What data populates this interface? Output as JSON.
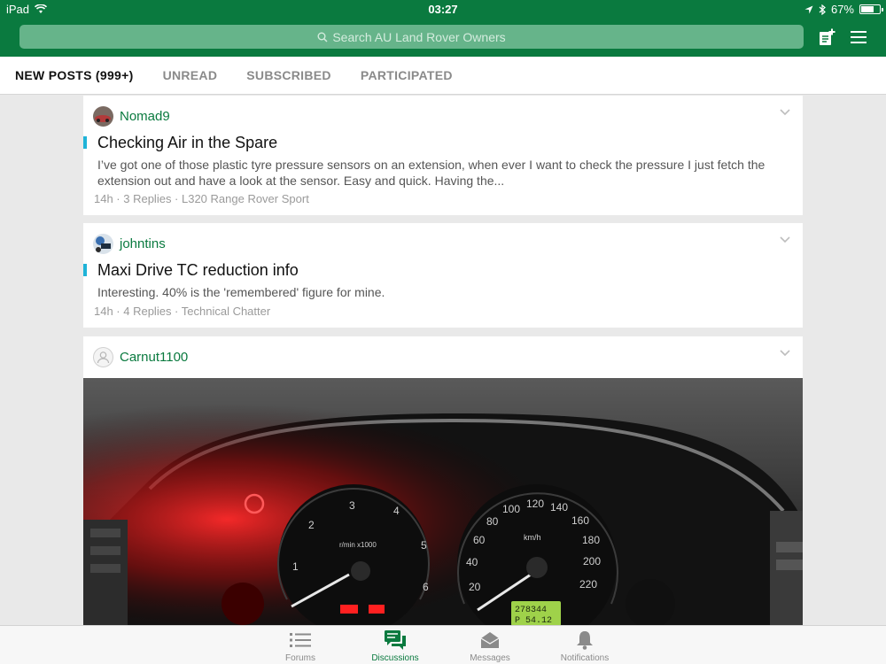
{
  "status_bar": {
    "device": "iPad",
    "time": "03:27",
    "battery": "67%"
  },
  "header": {
    "search_placeholder": "Search AU Land Rover Owners",
    "icons": [
      "new-post-icon",
      "hamburger-menu-icon"
    ]
  },
  "tabs": [
    {
      "label": "NEW POSTS (999+)",
      "active": true
    },
    {
      "label": "UNREAD",
      "active": false
    },
    {
      "label": "SUBSCRIBED",
      "active": false
    },
    {
      "label": "PARTICIPATED",
      "active": false
    }
  ],
  "posts": [
    {
      "author": "Nomad9",
      "title": "Checking Air in the Spare",
      "excerpt": "I’ve got one of those plastic tyre pressure sensors on an extension, when ever I want to check the pressure I just fetch the extension out and have a look at the sensor. Easy and quick. Having the...",
      "meta": "14h · 3 Replies · L320 Range Rover Sport"
    },
    {
      "author": "johntins",
      "title": "Maxi Drive TC reduction info",
      "excerpt": "Interesting. 40% is the 'remembered' figure for mine.",
      "meta": "14h · 4 Replies · Technical Chatter"
    },
    {
      "author": "Carnut1100",
      "photo": "car-dashboard-instrument-cluster-photo"
    }
  ],
  "dashboard_photo": {
    "rpm_label": "r/min x1000",
    "speed_unit": "km/h",
    "rpm_ticks": [
      "1",
      "2",
      "3",
      "4",
      "5",
      "6"
    ],
    "speed_ticks": [
      "20",
      "40",
      "60",
      "80",
      "100",
      "120",
      "140",
      "160",
      "180",
      "200",
      "220"
    ],
    "odometer": "278344",
    "gear_readout": "P 54.12"
  },
  "bottom_nav": [
    {
      "label": "Forums",
      "icon": "list-icon",
      "active": false
    },
    {
      "label": "Discussions",
      "icon": "chat-bubbles-icon",
      "active": true
    },
    {
      "label": "Messages",
      "icon": "envelope-icon",
      "active": false
    },
    {
      "label": "Notifications",
      "icon": "bell-icon",
      "active": false
    }
  ],
  "colors": {
    "brand_green": "#0a7a3f",
    "accent_bar": "#1fb3d8"
  }
}
